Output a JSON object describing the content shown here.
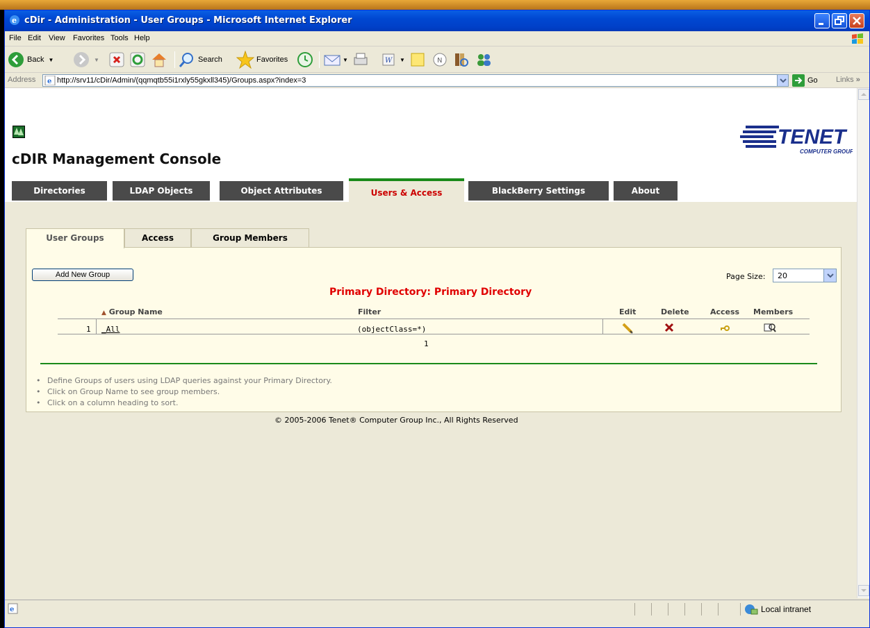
{
  "window": {
    "title": "cDir - Administration - User Groups - Microsoft Internet Explorer"
  },
  "menu": [
    "File",
    "Edit",
    "View",
    "Favorites",
    "Tools",
    "Help"
  ],
  "toolbar": {
    "back_label": "Back",
    "search_label": "Search",
    "favorites_label": "Favorites"
  },
  "address": {
    "label": "Address",
    "url": "http://srv11/cDir/Admin/(qqmqtb55i1rxly55gkxll345)/Groups.aspx?index=3",
    "go_label": "Go",
    "links_label": "Links"
  },
  "page": {
    "console_title": "cDIR Management Console",
    "logo_text": "TENET",
    "logo_sub": "COMPUTER GROUP",
    "main_tabs": [
      "Directories",
      "LDAP Objects",
      "Object Attributes",
      "Users & Access",
      "BlackBerry Settings",
      "About"
    ],
    "active_main_tab": "Users & Access",
    "sub_tabs": [
      "User Groups",
      "Access",
      "Group Members"
    ],
    "active_sub_tab": "User Groups",
    "add_button": "Add New Group",
    "page_size_label": "Page Size:",
    "page_size_value": "20",
    "directory_title": "Primary Directory: Primary Directory",
    "table": {
      "headers": {
        "group_name": "Group Name",
        "filter": "Filter",
        "edit": "Edit",
        "delete": "Delete",
        "access": "Access",
        "members": "Members"
      },
      "rows": [
        {
          "index": "1",
          "name": "_All",
          "filter": "(objectClass=*)"
        }
      ],
      "pager": "1"
    },
    "notes": [
      "Define Groups of users using LDAP queries against your Primary Directory.",
      "Click on Group Name to see group members.",
      "Click on a column heading to sort."
    ],
    "copyright": "© 2005-2006 Tenet® Computer Group Inc., All Rights Reserved"
  },
  "status": {
    "zone": "Local intranet"
  },
  "colors": {
    "title_bar": "#0047d1",
    "active_tab_text": "#cc0000",
    "active_tab_border": "#1a8a1a",
    "inactive_tab_bg": "#4a4a4a",
    "directory_title": "#e00000",
    "panel_bg": "#FFFCE8"
  }
}
